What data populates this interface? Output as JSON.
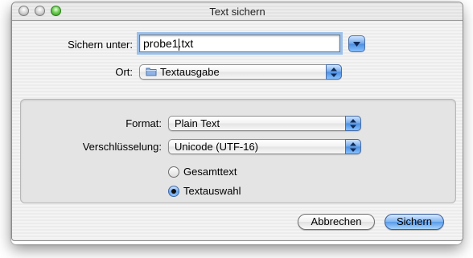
{
  "window": {
    "title": "Text sichern"
  },
  "save_as": {
    "label": "Sichern unter:",
    "value_before_cursor": "probe1",
    "value_after_cursor": ".txt"
  },
  "location": {
    "label": "Ort:",
    "selected": "Textausgabe",
    "icon": "folder-icon"
  },
  "format": {
    "label": "Format:",
    "selected": "Plain Text"
  },
  "encoding": {
    "label": "Verschlüsselung:",
    "selected": "Unicode (UTF-16)"
  },
  "scope": {
    "options": [
      {
        "label": "Gesamttext",
        "selected": false
      },
      {
        "label": "Textauswahl",
        "selected": true
      }
    ]
  },
  "buttons": {
    "cancel": "Abbrechen",
    "save": "Sichern"
  },
  "colors": {
    "accent": "#6fa7ea",
    "focus_ring": "#9cc0ea",
    "close_zoom_green": "#6fcf54"
  }
}
